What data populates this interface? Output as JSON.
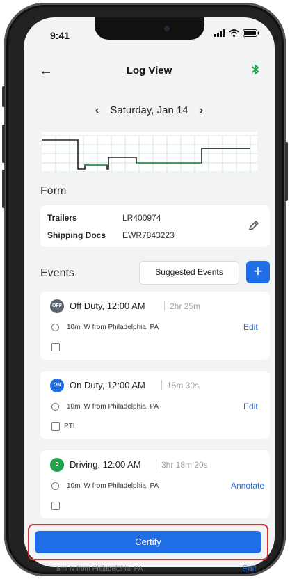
{
  "status_bar": {
    "time": "9:41"
  },
  "header": {
    "title": "Log View"
  },
  "date_nav": {
    "date": "Saturday, Jan 14"
  },
  "form": {
    "section_title": "Form",
    "trailers_label": "Trailers",
    "trailers_value": "LR400974",
    "shipping_label": "Shipping Docs",
    "shipping_value": "EWR7843223"
  },
  "events": {
    "section_title": "Events",
    "suggested_label": "Suggested Events",
    "add_label": "+",
    "items": [
      {
        "badge": "OFF",
        "badge_color": "#5b6270",
        "title": "Off Duty, 12:00 AM",
        "duration": "2hr 25m",
        "location": "10mi W from Philadelphia, PA",
        "action": "Edit",
        "note": ""
      },
      {
        "badge": "ON",
        "badge_color": "#1f6ee8",
        "title": "On Duty, 12:00 AM",
        "duration": "15m 30s",
        "location": "10mi W from Philadelphia, PA",
        "action": "Edit",
        "note": "PTI"
      },
      {
        "badge": "D",
        "badge_color": "#22a34a",
        "title": "Driving, 12:00 AM",
        "duration": "3hr 18m 20s",
        "location": "10mi W from Philadelphia, PA",
        "action": "Annotate",
        "note": ""
      }
    ]
  },
  "footer": {
    "certify_label": "Certify",
    "peek_location": "5mi N from Philadelphia, PA",
    "peek_action": "Edit"
  },
  "colors": {
    "accent": "#1f6ee8",
    "highlight": "#d9302e",
    "bluetooth": "#1aa34a"
  },
  "icons": [
    "back-arrow-icon",
    "bluetooth-icon",
    "chevron-left-icon",
    "chevron-right-icon",
    "edit-pencil-icon",
    "location-pin-icon",
    "note-icon"
  ]
}
